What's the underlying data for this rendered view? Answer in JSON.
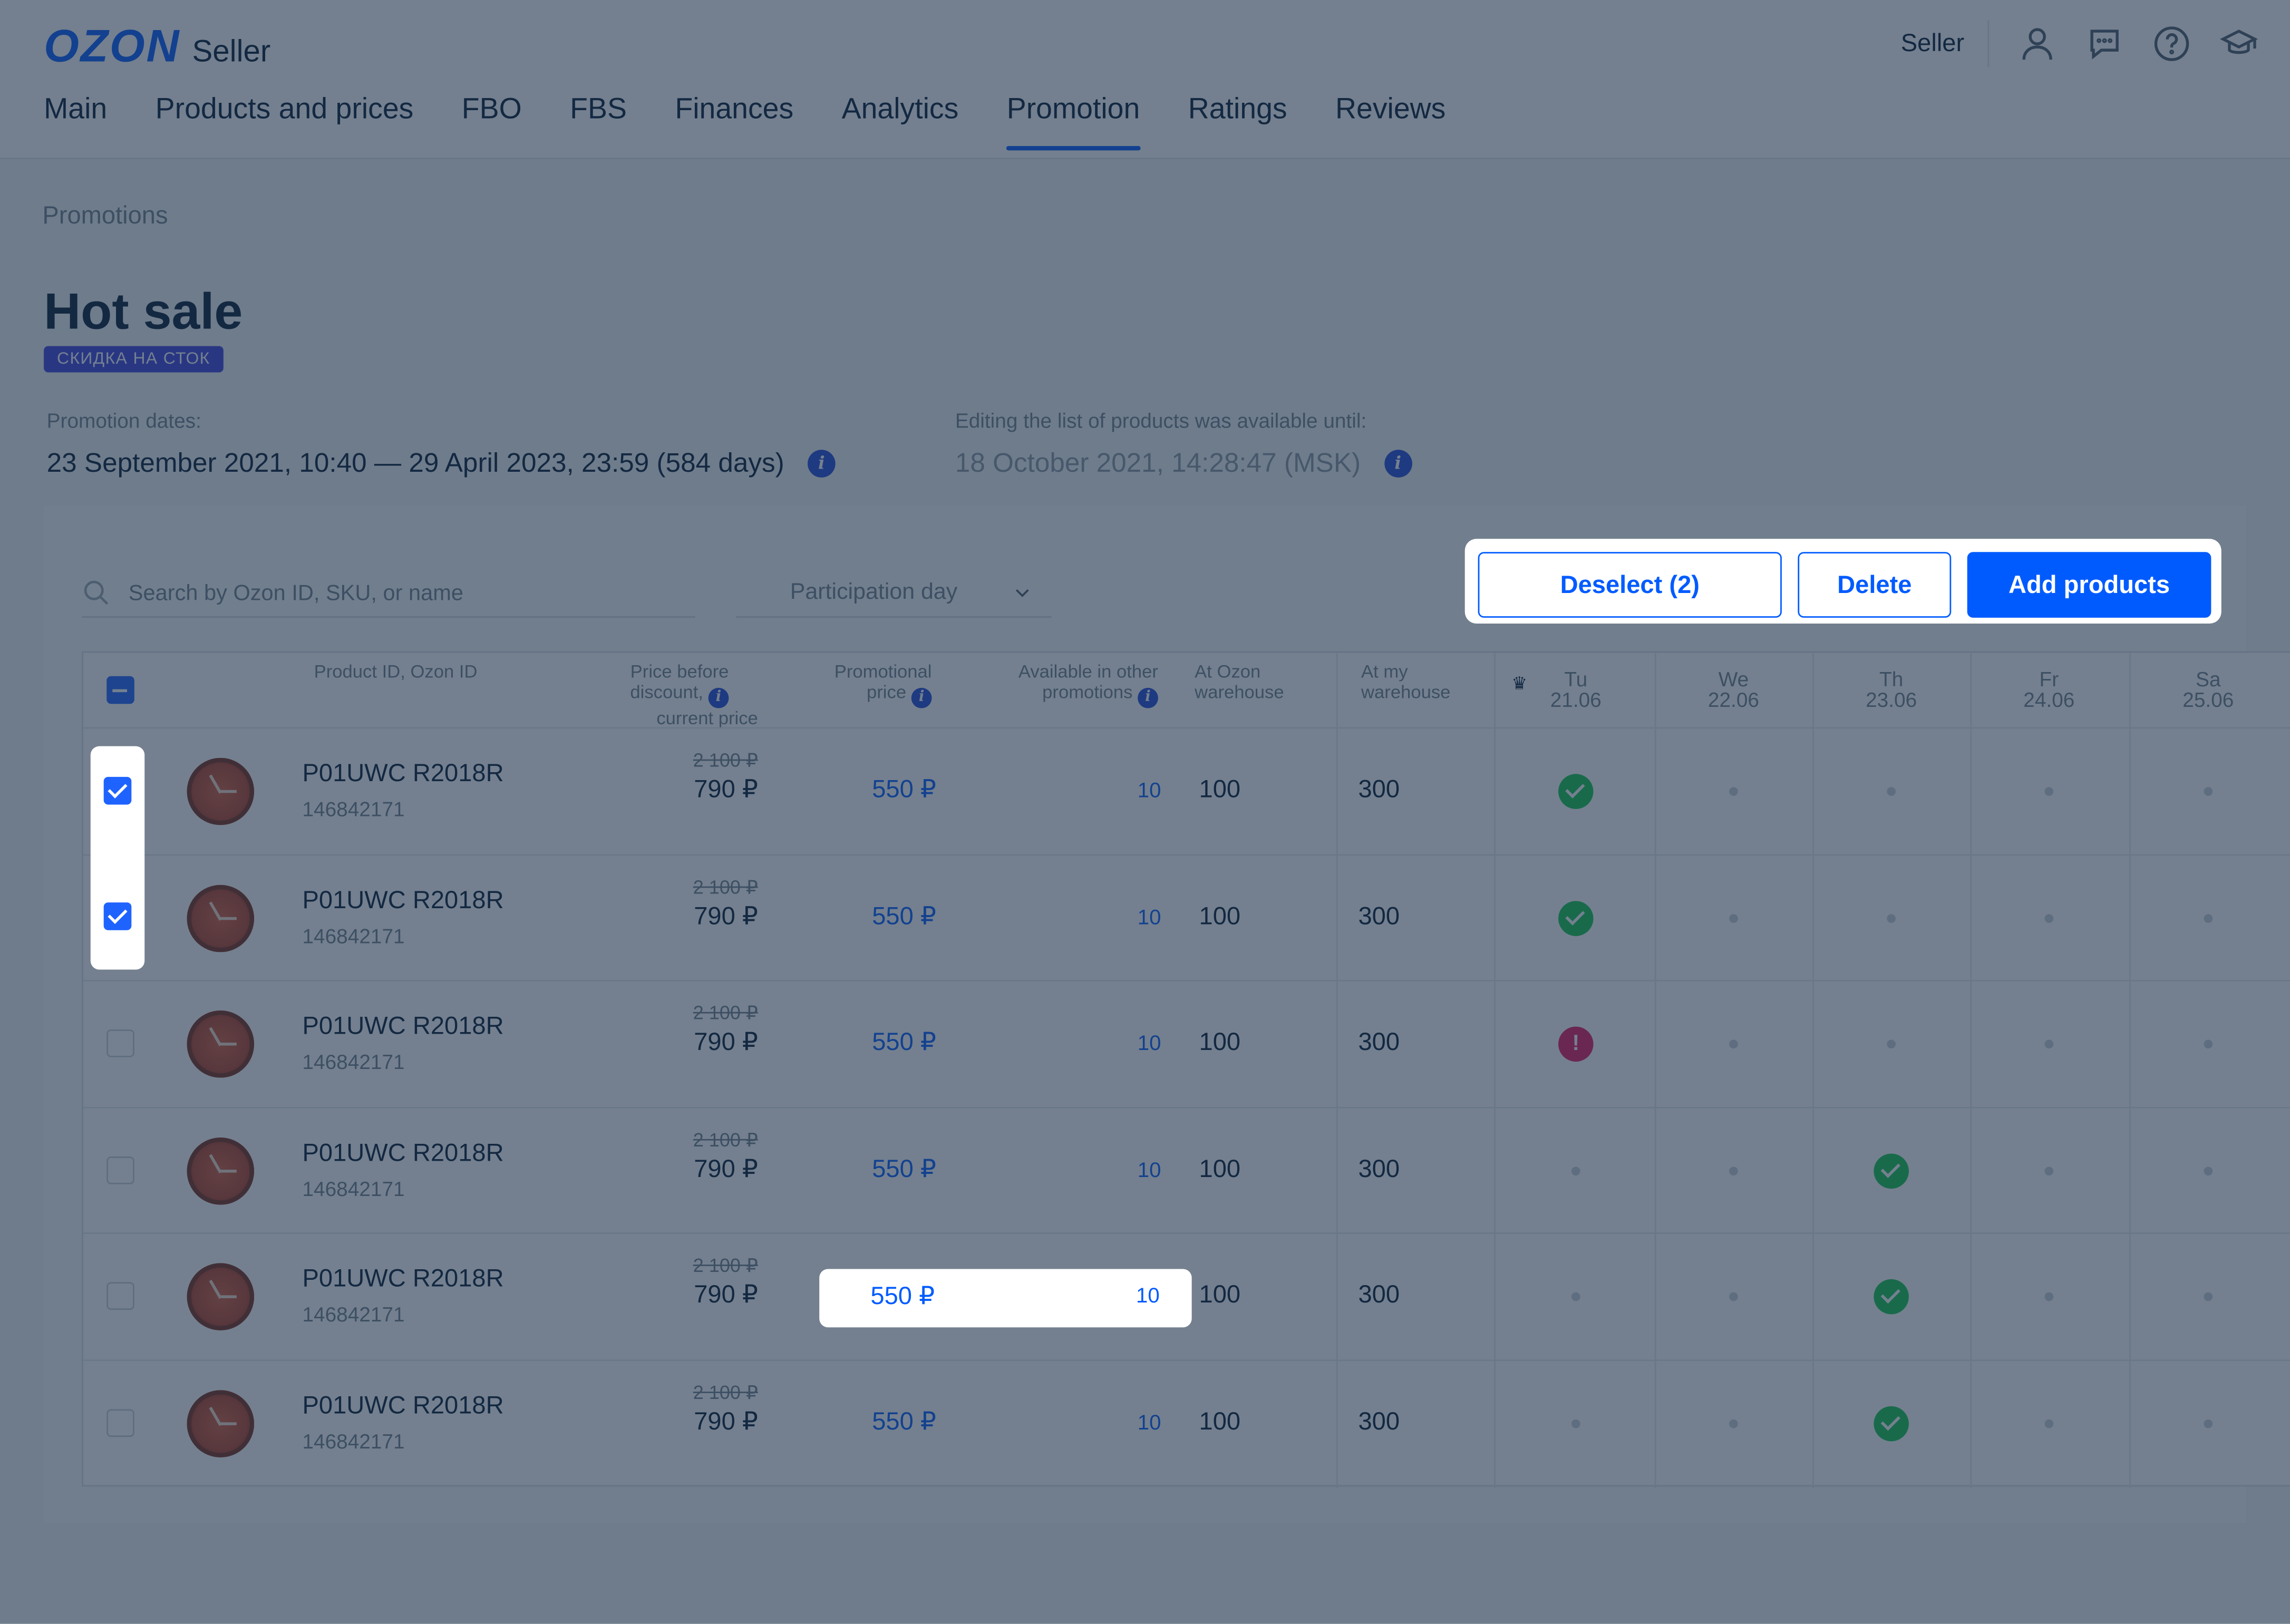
{
  "brand": {
    "logo_text": "OZON",
    "product": "Seller"
  },
  "header": {
    "user_label": "Seller",
    "icons": [
      "user-icon",
      "chat-icon",
      "help-icon",
      "education-icon"
    ]
  },
  "nav": {
    "tabs": [
      {
        "label": "Main"
      },
      {
        "label": "Products and prices"
      },
      {
        "label": "FBO"
      },
      {
        "label": "FBS"
      },
      {
        "label": "Finances"
      },
      {
        "label": "Analytics"
      },
      {
        "label": "Promotion",
        "active": true
      },
      {
        "label": "Ratings"
      },
      {
        "label": "Reviews"
      }
    ]
  },
  "breadcrumb": "Promotions",
  "page": {
    "title": "Hot sale",
    "badge": "СКИДКА НА СТОК",
    "promotion_dates_label": "Promotion dates:",
    "promotion_dates_value": "23 September 2021, 10:40 — 29 April 2023, 23:59 (584 days)",
    "editing_label": "Editing the list of products was available until:",
    "editing_value": "18 October 2021, 14:28:47 (MSK)"
  },
  "toolbar": {
    "search_placeholder": "Search by Ozon ID, SKU, or name",
    "participation_select": "Participation day",
    "deselect_label": "Deselect (2)",
    "delete_label": "Delete",
    "add_label": "Add products"
  },
  "table": {
    "headers": {
      "product": "Product ID, Ozon ID",
      "price_before_l1": "Price before",
      "price_before_l2": "discount,",
      "price_before_l3": "current price",
      "promo_l1": "Promotional",
      "promo_l2": "price",
      "avail_l1": "Available in other",
      "avail_l2": "promotions",
      "ozon_l1": "At Ozon",
      "ozon_l2": "warehouse",
      "my_l1": "At my",
      "my_l2": "warehouse"
    },
    "days": [
      {
        "day": "Tu",
        "date": "21.06",
        "crown": true
      },
      {
        "day": "We",
        "date": "22.06"
      },
      {
        "day": "Th",
        "date": "23.06"
      },
      {
        "day": "Fr",
        "date": "24.06"
      },
      {
        "day": "Sa",
        "date": "25.06"
      }
    ],
    "rows": [
      {
        "checked": true,
        "name": "P01UWC R2018R",
        "id": "146842171",
        "old_price": "2 100 ₽",
        "price": "790 ₽",
        "promo": "550 ₽",
        "available": "10",
        "ozon": "100",
        "mine": "300",
        "status": [
          "ok",
          "none",
          "none",
          "none",
          "none"
        ]
      },
      {
        "checked": true,
        "name": "P01UWC R2018R",
        "id": "146842171",
        "old_price": "2 100 ₽",
        "price": "790 ₽",
        "promo": "550 ₽",
        "available": "10",
        "ozon": "100",
        "mine": "300",
        "status": [
          "ok",
          "none",
          "none",
          "none",
          "none"
        ]
      },
      {
        "checked": false,
        "name": "P01UWC R2018R",
        "id": "146842171",
        "old_price": "2 100 ₽",
        "price": "790 ₽",
        "promo": "550 ₽",
        "available": "10",
        "ozon": "100",
        "mine": "300",
        "status": [
          "warn",
          "none",
          "none",
          "none",
          "none"
        ]
      },
      {
        "checked": false,
        "name": "P01UWC R2018R",
        "id": "146842171",
        "old_price": "2 100 ₽",
        "price": "790 ₽",
        "promo": "550 ₽",
        "available": "10",
        "ozon": "100",
        "mine": "300",
        "status": [
          "none",
          "none",
          "ok",
          "none",
          "none"
        ]
      },
      {
        "checked": false,
        "name": "P01UWC R2018R",
        "id": "146842171",
        "old_price": "2 100 ₽",
        "price": "790 ₽",
        "promo": "550 ₽",
        "available": "10",
        "ozon": "100",
        "mine": "300",
        "status": [
          "none",
          "none",
          "ok",
          "none",
          "none"
        ]
      },
      {
        "checked": false,
        "name": "P01UWC R2018R",
        "id": "146842171",
        "old_price": "2 100 ₽",
        "price": "790 ₽",
        "promo": "550 ₽",
        "available": "10",
        "ozon": "100",
        "mine": "300",
        "status": [
          "none",
          "none",
          "ok",
          "none",
          "none"
        ]
      }
    ]
  },
  "colors": {
    "accent": "#005bff",
    "success": "#10c44c",
    "danger": "#e4155d",
    "badge": "#3a3fe0"
  }
}
